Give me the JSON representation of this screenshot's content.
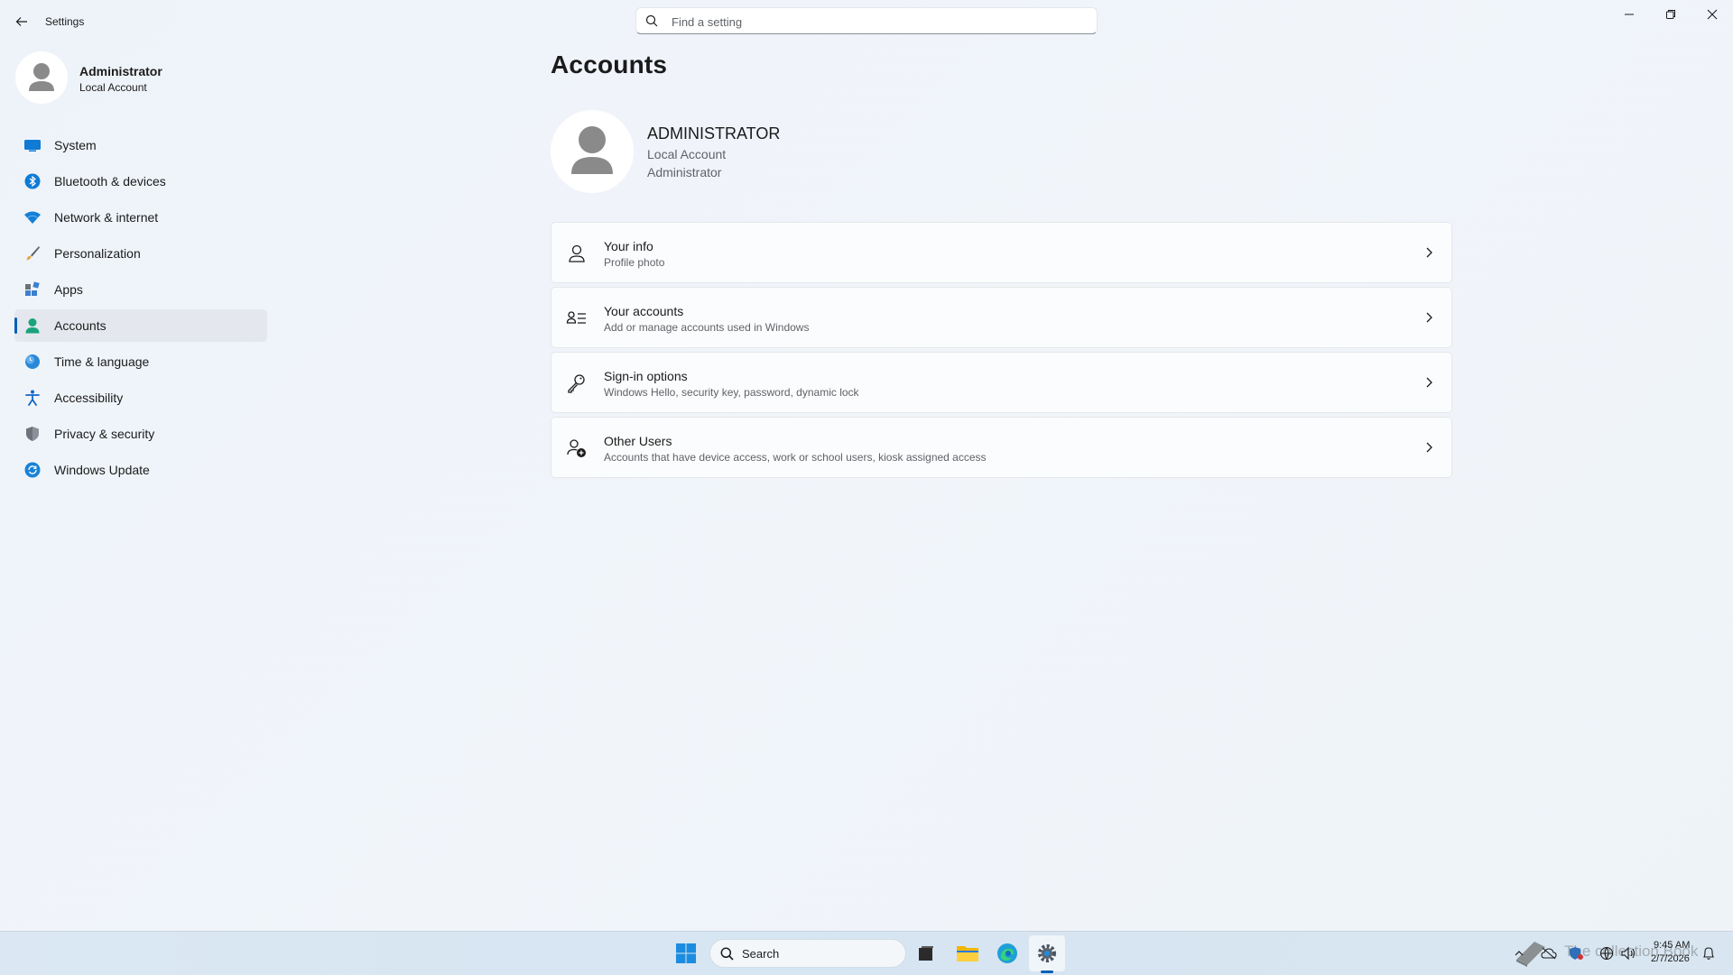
{
  "window": {
    "title": "Settings",
    "search_placeholder": "Find a setting"
  },
  "profile": {
    "name": "Administrator",
    "account_type": "Local Account"
  },
  "sidebar": {
    "items": [
      {
        "label": "System",
        "icon": "system-icon"
      },
      {
        "label": "Bluetooth & devices",
        "icon": "bluetooth-icon"
      },
      {
        "label": "Network & internet",
        "icon": "wifi-icon"
      },
      {
        "label": "Personalization",
        "icon": "brush-icon"
      },
      {
        "label": "Apps",
        "icon": "apps-icon"
      },
      {
        "label": "Accounts",
        "icon": "accounts-icon",
        "active": true
      },
      {
        "label": "Time & language",
        "icon": "clock-globe-icon"
      },
      {
        "label": "Accessibility",
        "icon": "accessibility-icon"
      },
      {
        "label": "Privacy & security",
        "icon": "shield-icon"
      },
      {
        "label": "Windows Update",
        "icon": "update-icon"
      }
    ]
  },
  "main": {
    "title": "Accounts",
    "account": {
      "name": "ADMINISTRATOR",
      "type": "Local Account",
      "role": "Administrator"
    },
    "cards": [
      {
        "title": "Your info",
        "subtitle": "Profile photo",
        "icon": "person-icon"
      },
      {
        "title": "Your accounts",
        "subtitle": "Add or manage accounts used in Windows",
        "icon": "accounts-list-icon"
      },
      {
        "title": "Sign-in options",
        "subtitle": "Windows Hello, security key, password, dynamic lock",
        "icon": "key-icon"
      },
      {
        "title": "Other Users",
        "subtitle": "Accounts that have device access, work or school users, kiosk assigned access",
        "icon": "add-person-icon"
      }
    ]
  },
  "taskbar": {
    "search_label": "Search",
    "time": "9:45 AM",
    "date": "2/7/2026",
    "watermark": "The collection Book"
  },
  "colors": {
    "accent": "#005fb8",
    "background": "#eef3f9"
  }
}
